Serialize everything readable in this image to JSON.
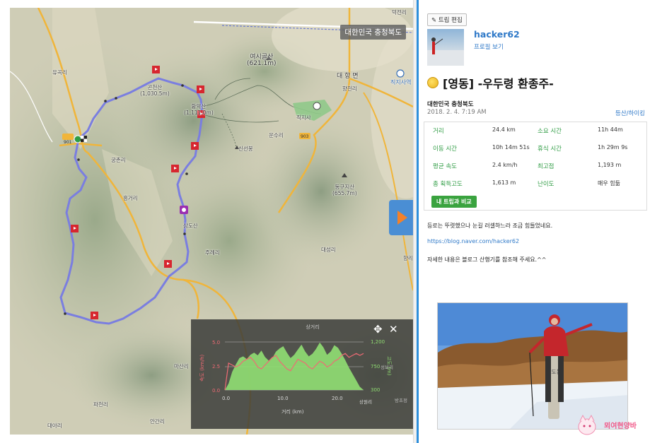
{
  "map": {
    "region_badge": "대한민국 충청북도",
    "labels": {
      "yeosigol": "여시골산\n(621.1m)",
      "daehangmyeon": "대 항 면",
      "jikjisa_station": "직지사역",
      "hyangcheonri": "향천리",
      "yujokri": "유곡리",
      "gonchansan": "곤천산\n(1,030.5m)",
      "hwangaksan": "황악산\n(1,111.0m)",
      "jikjisa": "직지사",
      "unsuri": "운수리",
      "sinseonbong": "신선봉",
      "gungchonri": "궁촌리",
      "honggeori": "흥거리",
      "dongguji": "동구지산\n(655.7m)",
      "samdosan": "삼도산",
      "jugyeori": "주례리",
      "daeseongri": "대성리",
      "hyangri": "향리",
      "masanri": "마산리",
      "pacheonri": "파천리",
      "daeari": "대아리",
      "angari": "안간리",
      "deokjeonri": "덕전리"
    },
    "road_numbers": [
      "901",
      "903"
    ]
  },
  "elevation": {
    "title": "상거리",
    "xlabel": "거리 (km)",
    "ylabel_left": "속도 (km/h)",
    "ylabel_right": "고도 (m)",
    "left_ticks": [
      "5.0",
      "2.5",
      "0.0"
    ],
    "right_ticks": [
      "1,200",
      "750",
      "300"
    ],
    "x_ticks": [
      "0.0",
      "10.0",
      "20.0"
    ],
    "right_tick_extra": "상원리",
    "corner_label": "방초정",
    "right_extra": "성보리",
    "move_icon": "✥",
    "close_icon": "✕"
  },
  "panel": {
    "edit_label": "트립 편집",
    "username": "hacker62",
    "profile_link": "프로필 보기",
    "title": "[영동] -우두령 환종주-",
    "region": "대한민국 충청북도",
    "date": "2018. 2. 4. 7:19 AM",
    "category": "등산/하이킹",
    "stats": [
      {
        "l1": "거리",
        "v1": "24.4 km",
        "l2": "소요 시간",
        "v2": "11h 44m"
      },
      {
        "l1": "이동 시간",
        "v1": "10h 14m 51s",
        "l2": "휴식 시간",
        "v2": "1h 29m 9s"
      },
      {
        "l1": "평균 속도",
        "v1": "2.4 km/h",
        "l2": "최고점",
        "v2": "1,193 m"
      },
      {
        "l1": "총 획득고도",
        "v1": "1,613 m",
        "l2": "난이도",
        "v2": "매우 힘듦"
      }
    ],
    "compare_label": "내 트립과 비교",
    "desc1": "등로는 뚜렷했으나 눈길 러셀하느라 조금 힘들었네요.",
    "link": "https://blog.naver.com/hacker62",
    "desc2": "자세한 내용은 블로그 산행기를 참조해 주세요.^^",
    "photo_sign": "삼도봉",
    "watermark": "뫼여현양바"
  },
  "colors": {
    "accent_blue": "#2f79c8",
    "stat_green": "#2f9c44",
    "track_purple": "#7a7ee0",
    "arrow_orange": "#f3812a"
  }
}
